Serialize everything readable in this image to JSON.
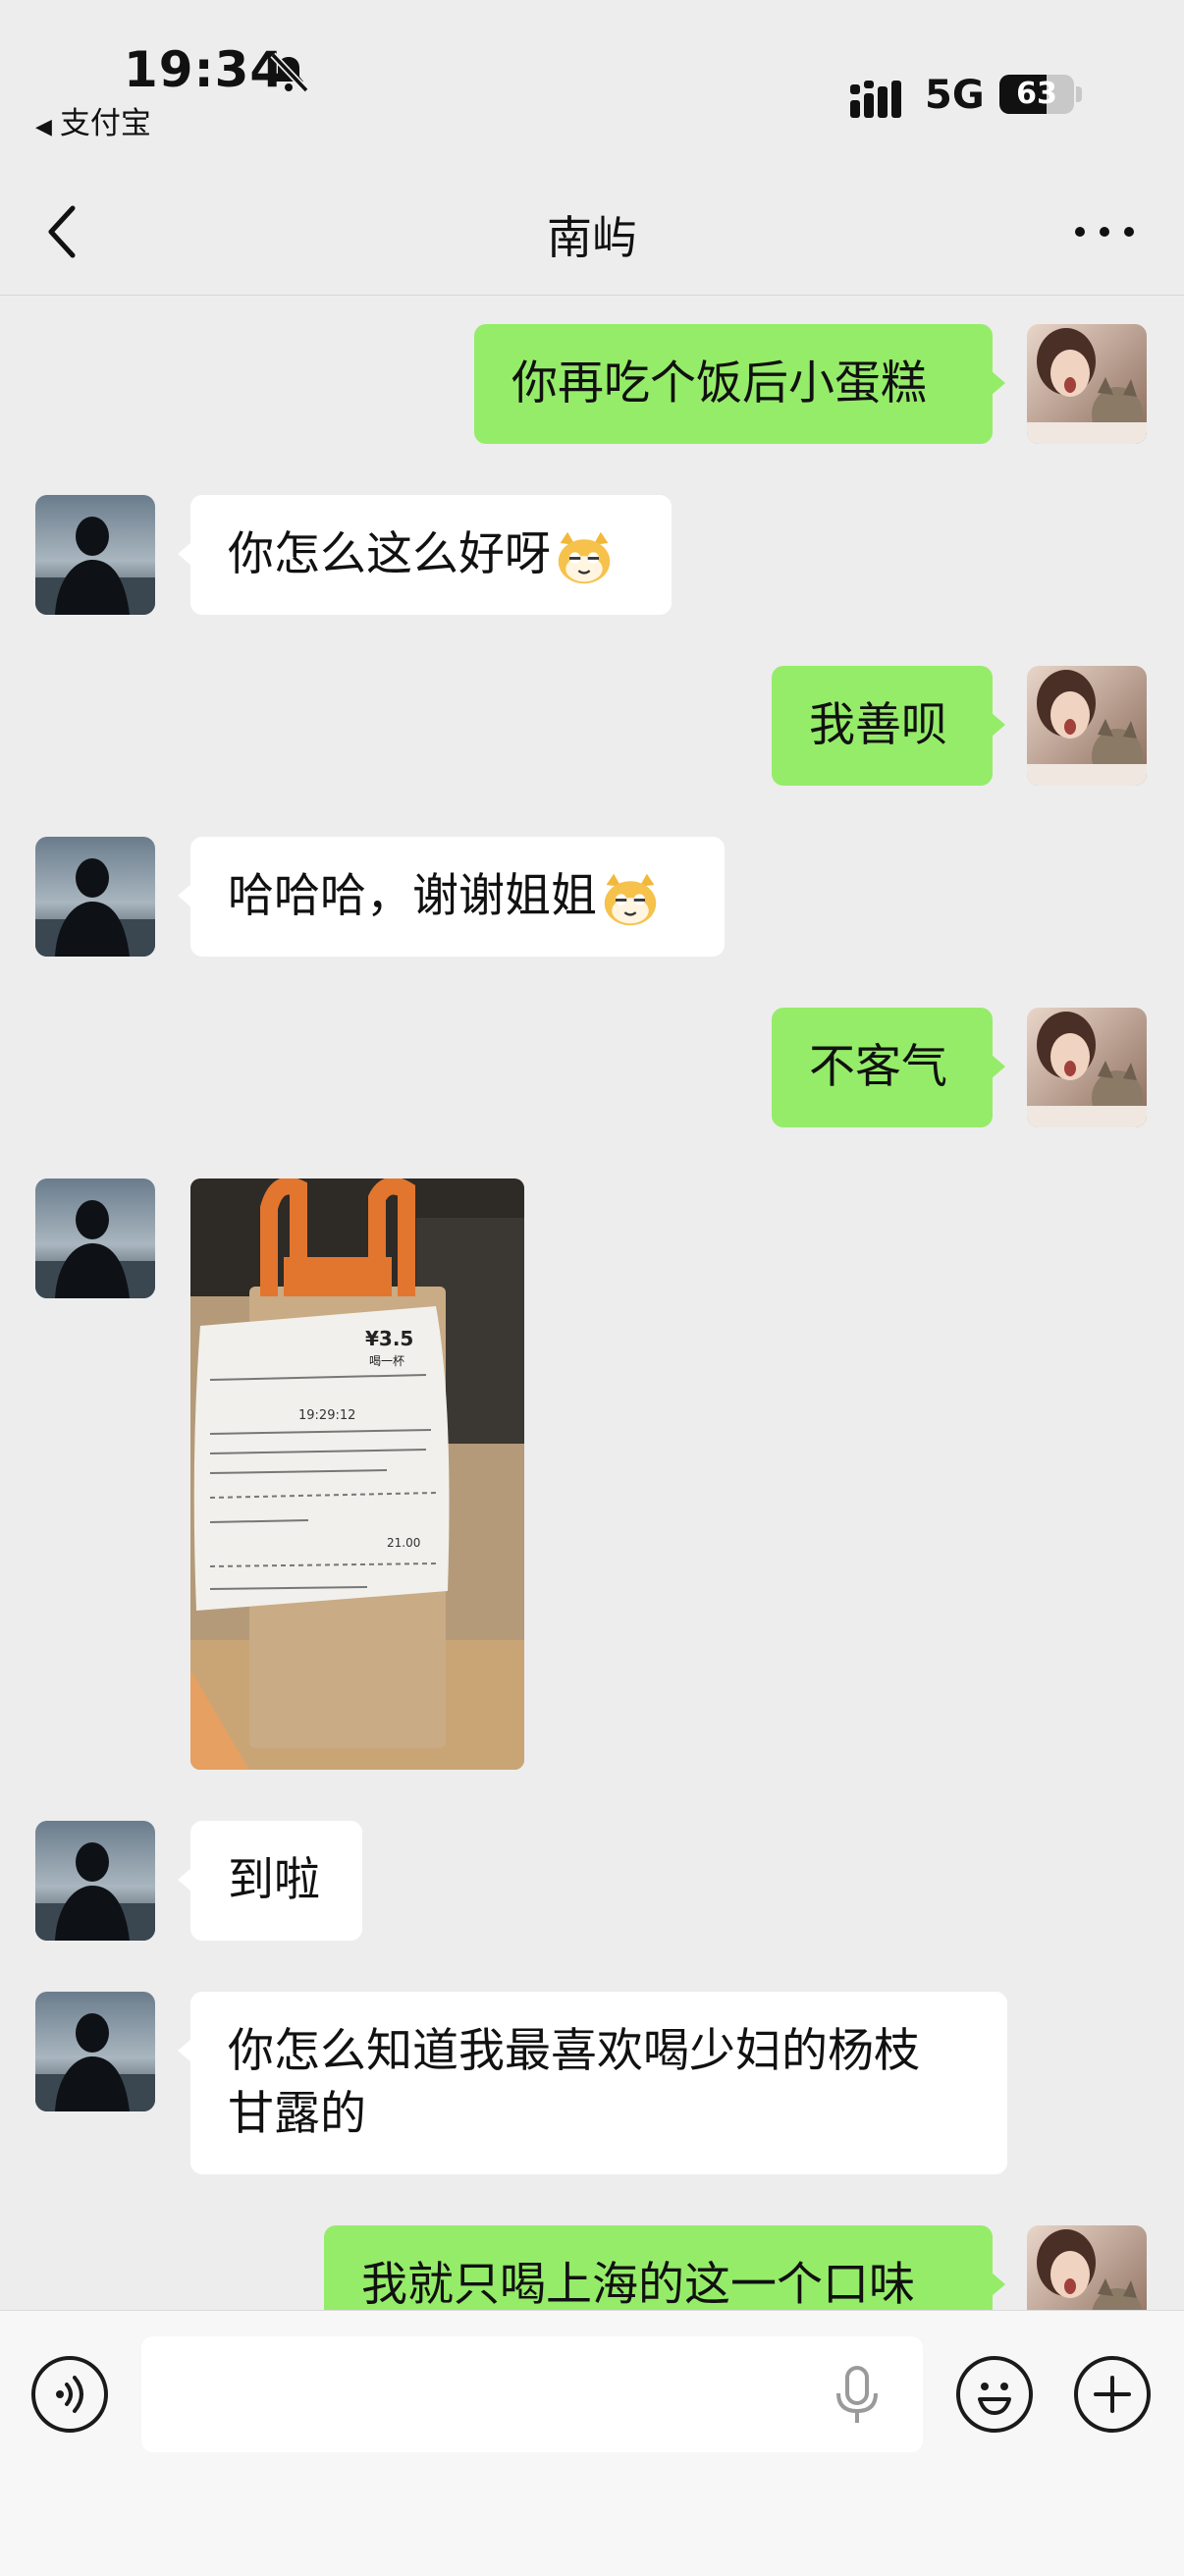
{
  "status_bar": {
    "time": "19:34",
    "back_app": "支付宝",
    "network": "5G",
    "battery": "63",
    "battery_level": 0.63
  },
  "header": {
    "title": "南屿"
  },
  "messages": [
    {
      "side": "out",
      "text": "你再吃个饭后小蛋糕"
    },
    {
      "side": "in",
      "text": "你怎么这么好呀",
      "emoji": "cat-emoji"
    },
    {
      "side": "out",
      "text": "我善呗"
    },
    {
      "side": "in",
      "text": "哈哈哈，谢谢姐姐",
      "emoji": "cat-emoji"
    },
    {
      "side": "out",
      "text": "不客气"
    },
    {
      "side": "in",
      "type": "photo",
      "photo_text": {
        "price": "¥3.5",
        "promo": "喝一杯",
        "time": "19:29:12",
        "amount": "21.00"
      }
    },
    {
      "side": "in",
      "text": "到啦"
    },
    {
      "side": "in",
      "text_line1": "你怎么知道我最喜欢喝少妇的杨枝",
      "text_line2": "甘露的"
    },
    {
      "side": "out",
      "text": "我就只喝上海的这一个口味"
    }
  ],
  "input_bar": {
    "placeholder": ""
  },
  "colors": {
    "background": "#ededed",
    "out_bubble": "#95ec69",
    "in_bubble": "#ffffff"
  },
  "icons": [
    "bell-slash-icon",
    "signal-icon",
    "back-chevron-icon",
    "more-icon",
    "voice-icon",
    "mic-icon",
    "emoji-icon",
    "plus-icon"
  ]
}
